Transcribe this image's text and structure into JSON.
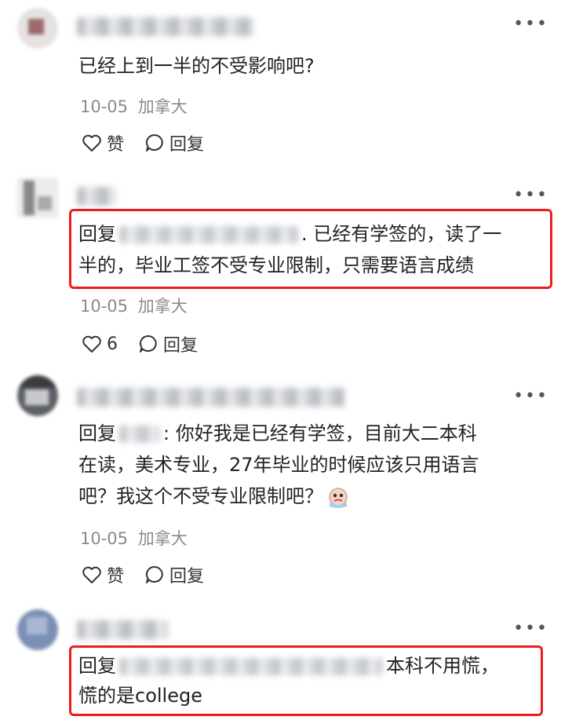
{
  "comments": [
    {
      "body": "已经上到一半的不受影响吧?",
      "date": "10-05",
      "location": "加拿大",
      "like_label": "赞",
      "reply_label": "回复"
    },
    {
      "reply_prefix": "回复",
      "body_after": ". 已经有学签的，读了一",
      "body_line2": "半的，毕业工签不受专业限制，只需要语言成绩",
      "date": "10-05",
      "location": "加拿大",
      "like_count": "6",
      "reply_label": "回复"
    },
    {
      "reply_prefix": "回复",
      "body_line1": ": 你好我是已经有学签，目前大二本科",
      "body_line2": "在读，美术专业，27年毕业的时候应该只用语言",
      "body_line3": "吧？我这个不受专业限制吧？",
      "date": "10-05",
      "location": "加拿大",
      "like_label": "赞",
      "reply_label": "回复"
    },
    {
      "reply_prefix": "回复",
      "body_after": "本科不用慌，",
      "body_line2": "慌的是college"
    }
  ],
  "colors": {
    "highlight": "#ee1c1c",
    "meta": "#8a8a8a"
  },
  "icons": [
    "more-icon",
    "heart-icon",
    "comment-bubble-icon",
    "crying-emoji-icon"
  ]
}
